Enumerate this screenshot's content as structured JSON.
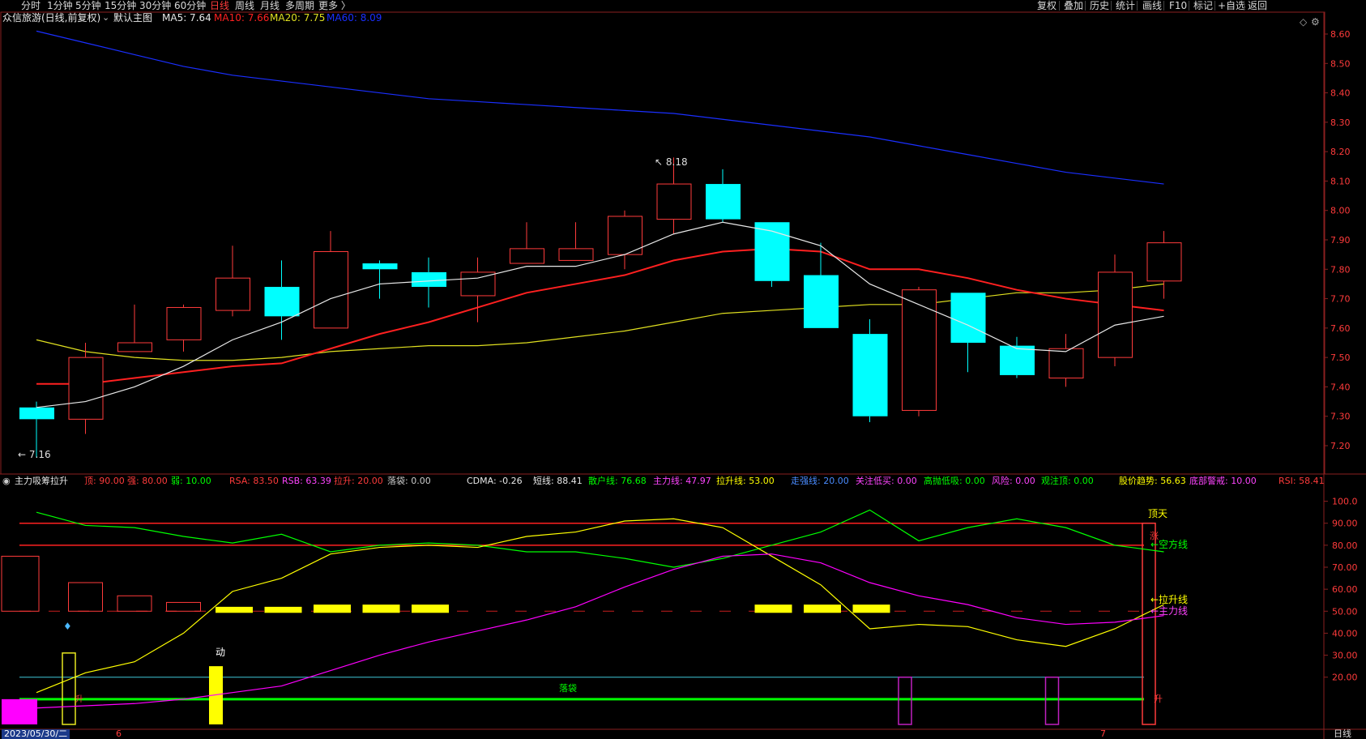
{
  "toolbar": {
    "periods": [
      "分时",
      "1分钟",
      "5分钟",
      "15分钟",
      "30分钟",
      "60分钟",
      "日线",
      "周线",
      "月线",
      "多周期",
      "更多 〉"
    ],
    "active_period": "日线",
    "right_buttons": [
      "复权",
      "叠加",
      "历史",
      "统计",
      "画线",
      "F10",
      "标记",
      "+自选",
      "返回"
    ]
  },
  "main_info": {
    "stock_title": "众信旅游(日线,前复权)",
    "chart_mode": "默认主图",
    "ma5": "MA5: 7.64",
    "ma10": "MA10: 7.66",
    "ma20": "MA20: 7.75",
    "ma60": "MA60: 8.09"
  },
  "main_chart": {
    "high_label": "8.18",
    "low_label": "7.16",
    "price_ticks": [
      "8.60",
      "8.50",
      "8.40",
      "8.30",
      "8.20",
      "8.10",
      "8.00",
      "7.90",
      "7.80",
      "7.70",
      "7.60",
      "7.50",
      "7.40",
      "7.30",
      "7.20"
    ]
  },
  "indicator_info": {
    "name": "主力吸筹拉升",
    "top": "顶: 90.00",
    "strong": "强: 80.00",
    "weak": "弱: 10.00",
    "rsa": "RSA: 83.50",
    "rsb": "RSB: 63.39",
    "lift": "拉升: 20.00",
    "drop": "落袋: 0.00",
    "cdma": "CDMA: -0.26",
    "short_line": "短线: 88.41",
    "retail": "散户线: 76.68",
    "main_force": "主力线: 47.97",
    "lift_line": "拉升线: 53.00",
    "strong_walk": "走强线: 20.00",
    "watch_low": "关注低买: 0.00",
    "high_throw": "高抛低吸: 0.00",
    "risk": "风险: 0.00",
    "watch_top": "观注顶: 0.00",
    "trend": "股价趋势: 56.63",
    "bottom_warn": "底部警戒: 10.00",
    "rsi": "RSI: 58.41"
  },
  "indicator_chart": {
    "ticks": [
      "100.0",
      "90.00",
      "80.00",
      "70.00",
      "60.00",
      "50.00",
      "40.00",
      "30.00",
      "20.00"
    ],
    "label_top_sky": "顶天",
    "label_rise": "涨",
    "label_empty_line": "←空方线",
    "label_lift_line": "←拉升线",
    "label_main_line": "←主力线",
    "label_move": "动",
    "label_drop_bag": "落袋",
    "label_sheng": "升",
    "label_sheng2": "升"
  },
  "bottom": {
    "date": "2023/05/30/二",
    "month_6": "6",
    "month_7": "7",
    "period": "日线"
  },
  "colors": {
    "up": "#ff3b3b",
    "down": "#00ffff",
    "ma5": "#e8e8e8",
    "ma10": "#ff2020",
    "ma20": "#e0e020",
    "ma60": "#1a2fff",
    "magenta": "#ff00ff",
    "green": "#00ff00",
    "yellow": "#ffff00"
  },
  "chart_data": {
    "type": "candlestick",
    "title": "众信旅游(日线,前复权)",
    "ylim": [
      7.15,
      8.65
    ],
    "candles": [
      {
        "o": 7.33,
        "c": 7.29,
        "h": 7.35,
        "l": 7.16
      },
      {
        "o": 7.29,
        "c": 7.5,
        "h": 7.55,
        "l": 7.24
      },
      {
        "o": 7.52,
        "c": 7.55,
        "h": 7.68,
        "l": 7.52
      },
      {
        "o": 7.56,
        "c": 7.67,
        "h": 7.68,
        "l": 7.52
      },
      {
        "o": 7.66,
        "c": 7.77,
        "h": 7.88,
        "l": 7.64
      },
      {
        "o": 7.74,
        "c": 7.64,
        "h": 7.83,
        "l": 7.56
      },
      {
        "o": 7.6,
        "c": 7.86,
        "h": 7.93,
        "l": 7.6
      },
      {
        "o": 7.82,
        "c": 7.8,
        "h": 7.83,
        "l": 7.7
      },
      {
        "o": 7.79,
        "c": 7.74,
        "h": 7.84,
        "l": 7.67
      },
      {
        "o": 7.71,
        "c": 7.79,
        "h": 7.84,
        "l": 7.62
      },
      {
        "o": 7.82,
        "c": 7.87,
        "h": 7.96,
        "l": 7.82
      },
      {
        "o": 7.83,
        "c": 7.87,
        "h": 7.96,
        "l": 7.83
      },
      {
        "o": 7.85,
        "c": 7.98,
        "h": 8.0,
        "l": 7.8
      },
      {
        "o": 7.97,
        "c": 8.09,
        "h": 8.18,
        "l": 7.92
      },
      {
        "o": 8.09,
        "c": 7.97,
        "h": 8.14,
        "l": 7.96
      },
      {
        "o": 7.96,
        "c": 7.76,
        "h": 7.96,
        "l": 7.74
      },
      {
        "o": 7.78,
        "c": 7.6,
        "h": 7.89,
        "l": 7.6
      },
      {
        "o": 7.58,
        "c": 7.3,
        "h": 7.63,
        "l": 7.28
      },
      {
        "o": 7.32,
        "c": 7.73,
        "h": 7.74,
        "l": 7.3
      },
      {
        "o": 7.72,
        "c": 7.55,
        "h": 7.72,
        "l": 7.45
      },
      {
        "o": 7.54,
        "c": 7.44,
        "h": 7.57,
        "l": 7.43
      },
      {
        "o": 7.43,
        "c": 7.53,
        "h": 7.58,
        "l": 7.4
      },
      {
        "o": 7.5,
        "c": 7.79,
        "h": 7.85,
        "l": 7.47
      },
      {
        "o": 7.76,
        "c": 7.89,
        "h": 7.93,
        "l": 7.7
      }
    ],
    "ma5": [
      7.33,
      7.35,
      7.4,
      7.47,
      7.56,
      7.62,
      7.7,
      7.75,
      7.76,
      7.77,
      7.81,
      7.81,
      7.85,
      7.92,
      7.96,
      7.93,
      7.88,
      7.75,
      7.68,
      7.61,
      7.53,
      7.52,
      7.61,
      7.64
    ],
    "ma10": [
      7.41,
      7.41,
      7.43,
      7.45,
      7.47,
      7.48,
      7.53,
      7.58,
      7.62,
      7.67,
      7.72,
      7.75,
      7.78,
      7.83,
      7.86,
      7.87,
      7.86,
      7.8,
      7.8,
      7.77,
      7.73,
      7.7,
      7.68,
      7.66
    ],
    "ma20": [
      7.56,
      7.52,
      7.5,
      7.49,
      7.49,
      7.5,
      7.52,
      7.53,
      7.54,
      7.54,
      7.55,
      7.57,
      7.59,
      7.62,
      7.65,
      7.66,
      7.67,
      7.68,
      7.68,
      7.7,
      7.72,
      7.72,
      7.73,
      7.75
    ],
    "ma60": [
      8.61,
      8.57,
      8.53,
      8.49,
      8.46,
      8.44,
      8.42,
      8.4,
      8.38,
      8.37,
      8.36,
      8.35,
      8.34,
      8.33,
      8.31,
      8.29,
      8.27,
      8.25,
      8.22,
      8.19,
      8.16,
      8.13,
      8.11,
      8.09
    ],
    "indicator": {
      "ylim": [
        0,
        105
      ],
      "levels": [
        90,
        80,
        50,
        20,
        10
      ],
      "green_line": [
        95,
        89,
        88,
        84,
        81,
        85,
        77,
        80,
        81,
        80,
        77,
        77,
        74,
        70,
        74,
        80,
        86,
        96,
        82,
        88,
        92,
        88,
        80,
        77
      ],
      "yellow_line": [
        13,
        22,
        27,
        40,
        59,
        65,
        76,
        79,
        80,
        79,
        84,
        86,
        91,
        92,
        88,
        75,
        62,
        42,
        44,
        43,
        37,
        34,
        42,
        53
      ],
      "magenta_line": [
        6,
        7,
        8,
        10,
        13,
        16,
        23,
        30,
        36,
        41,
        46,
        52,
        61,
        69,
        75,
        76,
        72,
        63,
        57,
        53,
        47,
        44,
        45,
        48
      ],
      "left_bars": [
        75,
        63,
        57,
        54,
        52,
        52,
        53,
        53
      ],
      "yellow_bars": [
        52,
        52,
        53,
        53,
        53,
        0,
        0,
        0,
        0,
        0,
        0,
        53,
        53,
        53
      ],
      "purple_boxes": [
        18,
        21
      ]
    }
  }
}
